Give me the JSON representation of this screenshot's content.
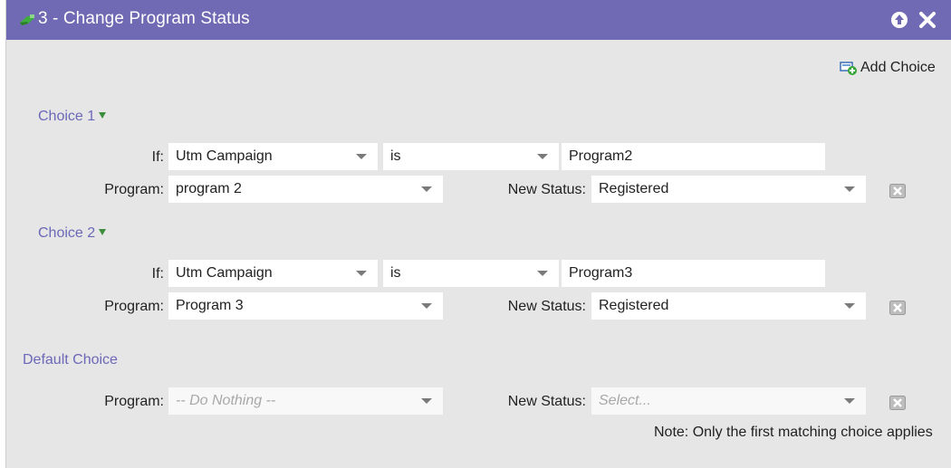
{
  "window": {
    "title": "3 - Change Program Status",
    "icons": [
      "flow-step-icon",
      "collapse-up-icon",
      "close-icon"
    ]
  },
  "toolbar": {
    "add_choice_label": "Add Choice",
    "add_choice_icon": "add-choice-icon"
  },
  "labels": {
    "if": "If:",
    "program": "Program:",
    "new_status": "New Status:"
  },
  "choices": [
    {
      "title": "Choice 1",
      "if_attribute": "Utm Campaign",
      "operator": "is",
      "value": "Program2",
      "program": "program 2",
      "new_status": "Registered"
    },
    {
      "title": "Choice 2",
      "if_attribute": "Utm Campaign",
      "operator": "is",
      "value": "Program3",
      "program": "Program 3",
      "new_status": "Registered"
    }
  ],
  "default_choice": {
    "title": "Default Choice",
    "program_placeholder": "-- Do Nothing --",
    "status_placeholder": "Select..."
  },
  "note": "Note: Only the first matching choice applies",
  "colors": {
    "titlebar": "#7069b3",
    "panel": "#e6e6e6",
    "choice_heading": "#6b68b8",
    "caret": "#3c8d3c"
  }
}
